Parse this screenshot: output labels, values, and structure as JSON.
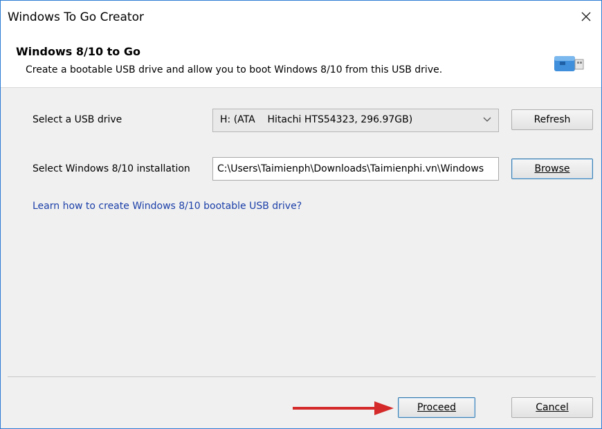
{
  "window": {
    "title": "Windows To Go Creator"
  },
  "header": {
    "title": "Windows 8/10 to Go",
    "subtitle": "Create a bootable USB drive and allow you to boot Windows 8/10 from this USB drive."
  },
  "form": {
    "usb_label": "Select a USB drive",
    "usb_selected": "H: (ATA    Hitachi HTS54323, 296.97GB)",
    "refresh_label": "Refresh",
    "install_label": "Select Windows 8/10 installation",
    "install_value": "C:\\Users\\Taimienph\\Downloads\\Taimienphi.vn\\Windows",
    "browse_label": "Browse",
    "learn_link": "Learn how to create Windows 8/10 bootable USB drive?"
  },
  "footer": {
    "proceed_label": "Proceed",
    "cancel_label": "Cancel"
  },
  "colors": {
    "window_border": "#2b7bd4",
    "link": "#1a3ea8",
    "arrow": "#d42a2a",
    "dialog_bg": "#f0f0f0"
  },
  "icons": [
    "close-icon",
    "usb-drive-icon",
    "chevron-down-icon",
    "arrow-right-icon"
  ]
}
